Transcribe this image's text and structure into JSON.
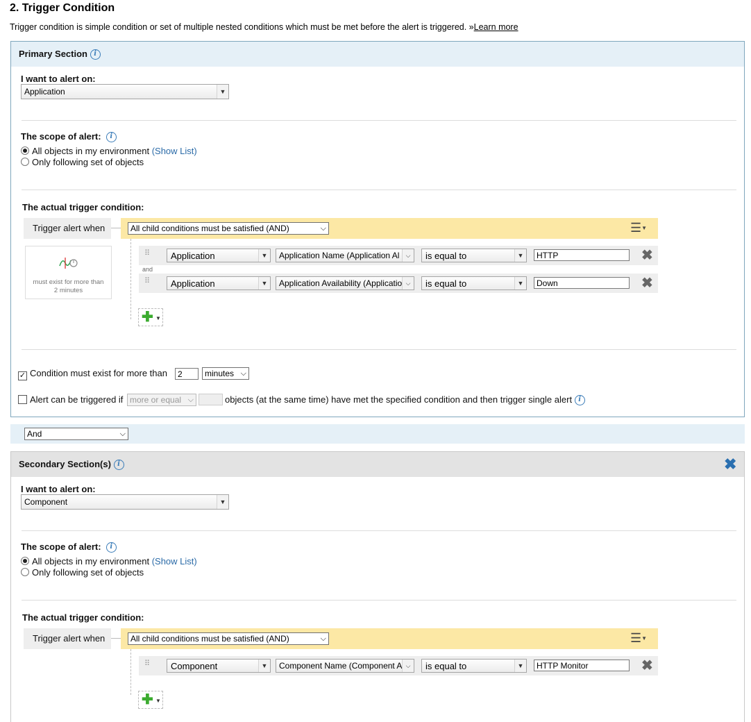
{
  "page": {
    "title": "2. Trigger Condition",
    "description": "Trigger condition is simple condition or set of multiple nested conditions which must be met before the alert is triggered. ",
    "learn_more_prefix": "»",
    "learn_more": "Learn more"
  },
  "primary": {
    "title": "Primary Section",
    "alert_on_label": "I want to alert on:",
    "alert_on_value": "Application",
    "scope_label": "The scope of alert:",
    "scope_option_all": "All objects in my environment",
    "show_list": "(Show List)",
    "scope_option_following": "Only following set of objects",
    "trigger_label": "The actual trigger condition:",
    "trigger_alert_when": "Trigger alert when",
    "condition_mode": "All child conditions must be satisfied (AND)",
    "thumbnail_text": "must exist for more than 2 minutes",
    "joiner": "and",
    "rows": [
      {
        "object": "Application",
        "field": "Application Name (Application Al",
        "operator": "is equal to",
        "value": "HTTP"
      },
      {
        "object": "Application",
        "field": "Application Availability (Applicatio",
        "operator": "is equal to",
        "value": "Down"
      }
    ],
    "condition_exist_label": "Condition must exist for more than",
    "condition_exist_value": "2",
    "condition_exist_unit": "minutes",
    "alert_triggered_label": "Alert can be triggered if",
    "more_or_equal": "more or equal",
    "objects_text": "objects (at the same time) have met the specified condition and then trigger single alert"
  },
  "joiner_select": "And",
  "secondary": {
    "title": "Secondary Section(s)",
    "alert_on_label": "I want to alert on:",
    "alert_on_value": "Component",
    "scope_label": "The scope of alert:",
    "scope_option_all": "All objects in my environment",
    "show_list": "(Show List)",
    "scope_option_following": "Only following set of objects",
    "trigger_label": "The actual trigger condition:",
    "trigger_alert_when": "Trigger alert when",
    "condition_mode": "All child conditions must be satisfied (AND)",
    "rows": [
      {
        "object": "Component",
        "field": "Component Name (Component A",
        "operator": "is equal to",
        "value": "HTTP Monitor"
      }
    ]
  },
  "icons": {
    "info": "info-icon",
    "menu": "hamburger-menu-icon",
    "delete": "close-icon",
    "add": "plus-icon",
    "grip": "drag-handle-icon"
  },
  "colors": {
    "primary_header": "#e5f0f7",
    "secondary_header": "#e3e3e3",
    "condition_bar": "#fce8a5",
    "link": "#2a6aa7",
    "add_green": "#3bab2f"
  }
}
